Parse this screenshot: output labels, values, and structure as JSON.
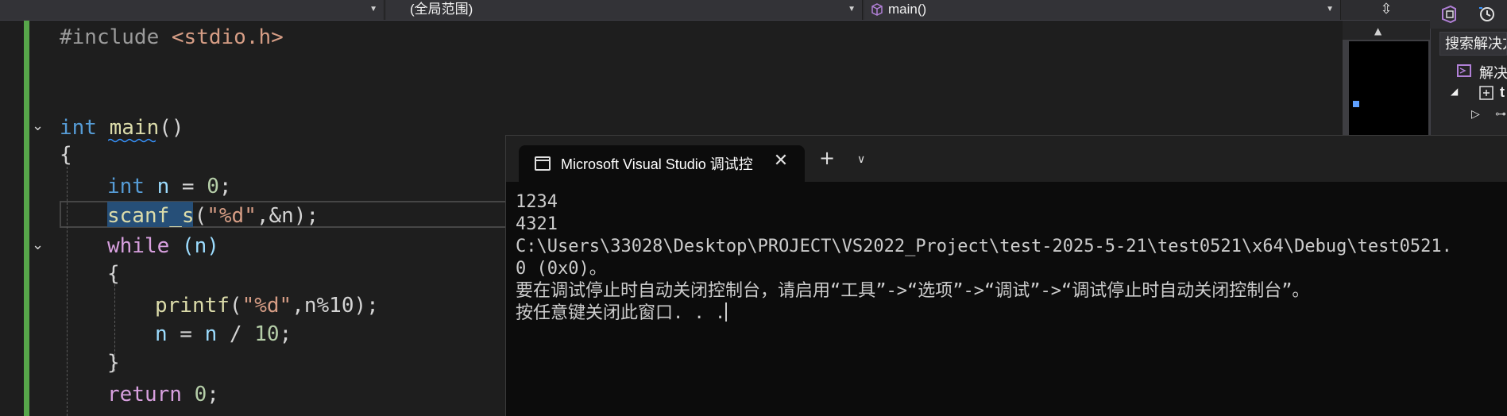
{
  "nav": {
    "scope_label": "(全局范围)",
    "function_label": "main()"
  },
  "editor": {
    "lines": {
      "include_directive": "#include",
      "include_header": "<stdio.h>",
      "main_type": "int",
      "main_name": "main",
      "main_parens": "()",
      "open_brace": "{",
      "decl_type": "int",
      "decl_rest_var": "n",
      "decl_rest_eq": " = ",
      "decl_value": "0",
      "decl_semicolon": ";",
      "scanf_name": "scanf_s",
      "scanf_open": "(",
      "scanf_fmt": "\"%d\"",
      "scanf_args": ",&n);",
      "while_kw": "while",
      "while_cond": " (n)",
      "inner_open": "{",
      "printf_name": "printf",
      "printf_open": "(",
      "printf_fmt": "\"%d\"",
      "printf_args": ",n%10);",
      "assign_var": "n",
      "assign_eq": " = ",
      "assign_rhs_var": "n",
      "assign_div": " / ",
      "assign_num": "10",
      "assign_semi": ";",
      "inner_close": "}",
      "return_kw": "return",
      "return_val": "0",
      "return_semi": ";"
    }
  },
  "solution_explorer": {
    "search_placeholder": "搜索解决方",
    "solution_label": "解决",
    "project_label": "t"
  },
  "console": {
    "tab_title": "Microsoft Visual Studio 调试控",
    "output_lines": [
      "1234",
      "4321",
      "C:\\Users\\33028\\Desktop\\PROJECT\\VS2022_Project\\test-2025-5-21\\test0521\\x64\\Debug\\test0521.",
      "0 (0x0)。",
      "要在调试停止时自动关闭控制台，请启用“工具”->“选项”->“调试”->“调试停止时自动关闭控制台”。",
      "按任意键关闭此窗口. . ."
    ]
  },
  "colors": {
    "editor_bg": "#1e1e1e",
    "keyword": "#569cd6",
    "function": "#dcdcaa",
    "string": "#d69d85",
    "number": "#b5cea8",
    "control": "#d8a0df",
    "change_bar": "#57a64a",
    "selection": "#264f78"
  }
}
